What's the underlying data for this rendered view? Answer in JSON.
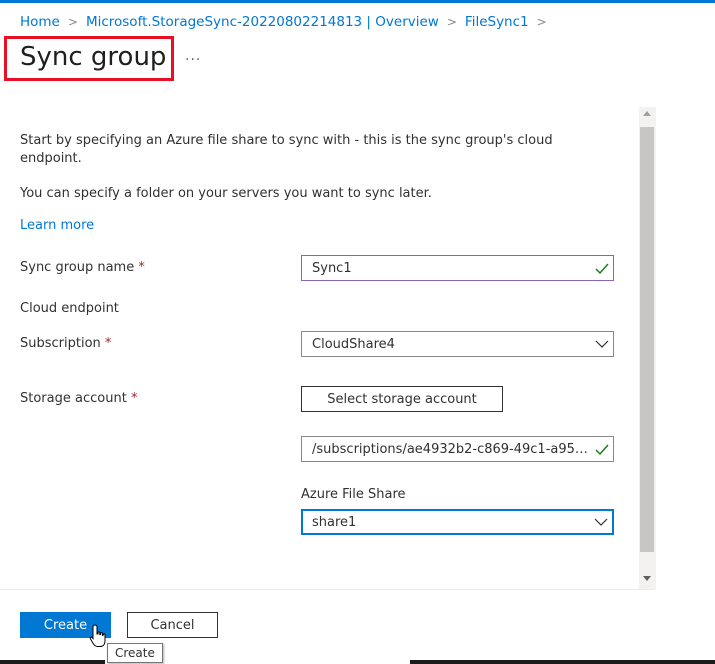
{
  "breadcrumb": {
    "items": [
      "Home",
      "Microsoft.StorageSync-20220802214813 | Overview",
      "FileSync1"
    ],
    "separator": ">"
  },
  "page": {
    "title": "Sync group",
    "more": "···"
  },
  "form": {
    "intro_line1": "Start by specifying an Azure file share to sync with - this is the sync group's cloud endpoint.",
    "intro_line2": "You can specify a folder on your servers you want to sync later.",
    "learn_more": "Learn more",
    "sync_group_name_label": "Sync group name",
    "sync_group_name_value": "Sync1",
    "cloud_endpoint_label": "Cloud endpoint",
    "subscription_label": "Subscription",
    "subscription_value": "CloudShare4",
    "storage_account_label": "Storage account",
    "select_storage_button": "Select storage account",
    "storage_account_value": "/subscriptions/ae4932b2-c869-49c1-a952...",
    "azure_file_share_label": "Azure File Share",
    "azure_file_share_value": "share1",
    "required_marker": "*"
  },
  "footer": {
    "create_label": "Create",
    "cancel_label": "Cancel",
    "tooltip": "Create"
  },
  "colors": {
    "accent": "#0078d4",
    "highlight_box": "#e81123",
    "valid_check": "#107c10",
    "required": "#a4262c"
  },
  "icons": {
    "valid": "checkmark-icon",
    "dropdown": "chevron-down-icon",
    "breadcrumb_sep": "chevron-right-icon"
  }
}
